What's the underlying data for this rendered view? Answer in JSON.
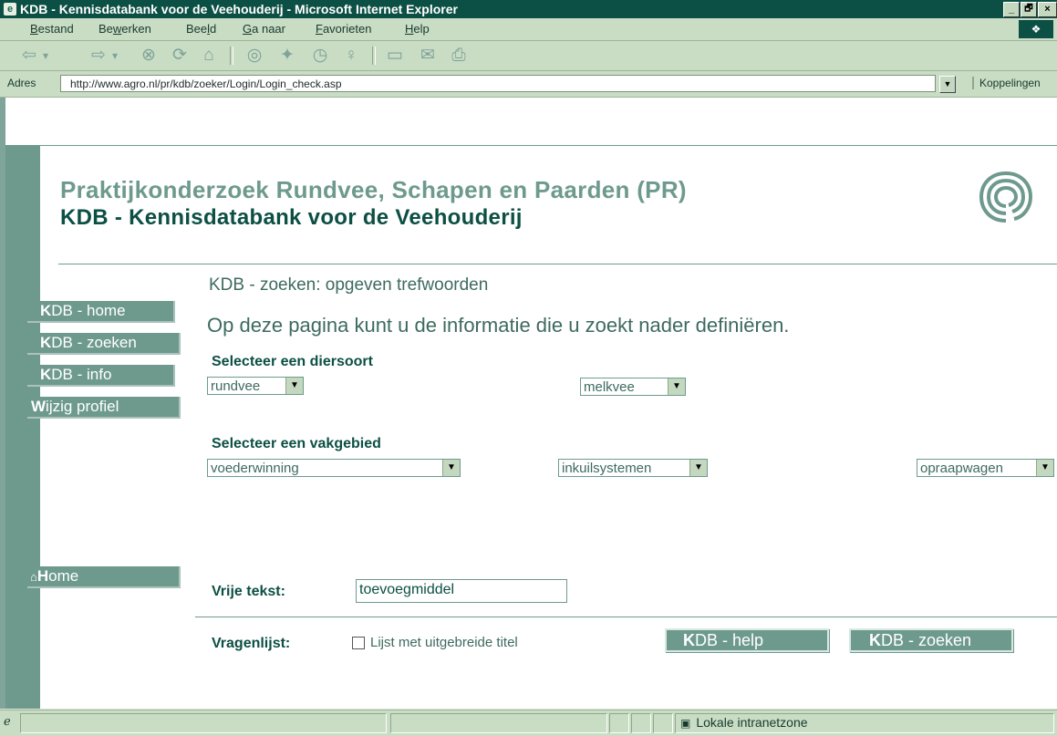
{
  "window": {
    "title": "KDB - Kennisdatabank voor de Veehouderij - Microsoft Internet Explorer",
    "controls": [
      "_",
      "🗗",
      "×"
    ]
  },
  "menu": {
    "items": [
      {
        "pre": "",
        "key": "B",
        "post": "estand"
      },
      {
        "pre": "Be",
        "key": "w",
        "post": "erken"
      },
      {
        "pre": "Bee",
        "key": "l",
        "post": "d"
      },
      {
        "pre": "",
        "key": "G",
        "post": "a naar"
      },
      {
        "pre": "",
        "key": "F",
        "post": "avorieten"
      },
      {
        "pre": "",
        "key": "H",
        "post": "elp"
      }
    ]
  },
  "toolbar": {
    "icons": [
      "back-icon",
      "back-dropdown-icon",
      "forward-icon",
      "forward-dropdown-icon",
      "stop-icon",
      "refresh-icon",
      "home-icon",
      "search-icon",
      "favorites-icon",
      "history-icon",
      "channels-icon",
      "fullscreen-icon",
      "mail-icon",
      "print-icon"
    ],
    "glyphs": {
      "back": "⇦",
      "drop": "▾",
      "forward": "⇨",
      "stop": "⊗",
      "refresh": "⟳",
      "home": "⌂",
      "search": "◎",
      "favorites": "✦",
      "history": "◷",
      "channels": "♀",
      "fullscreen": "▭",
      "mail": "✉",
      "print": "⎙"
    }
  },
  "address": {
    "label": "Adres",
    "url": "http://www.agro.nl/pr/kdb/zoeker/Login/Login_check.asp",
    "links_label": "Koppelingen"
  },
  "page": {
    "org_title": "Praktijkonderzoek Rundvee, Schapen en Paarden (PR)",
    "app_title": "KDB - Kennisdatabank voor de Veehouderij",
    "section_title": "KDB - zoeken: opgeven trefwoorden",
    "intro": "Op deze pagina kunt u de informatie die u zoekt nader definiëren.",
    "nav": [
      {
        "k": "K",
        "rest": "DB - home"
      },
      {
        "k": "K",
        "rest": "DB - zoeken"
      },
      {
        "k": "K",
        "rest": "DB - info"
      },
      {
        "k": "W",
        "rest": "ijzig profiel"
      }
    ],
    "home_nav": {
      "k": "H",
      "rest": "ome"
    },
    "animal": {
      "label": "Selecteer een diersoort",
      "species": "rundvee",
      "subtype": "melkvee"
    },
    "field": {
      "label": "Selecteer een vakgebied",
      "area": "voederwinning",
      "topic": "inkuilsystemen",
      "subtopic": "opraapwagen"
    },
    "free_text": {
      "label": "Vrije tekst:",
      "value": "toevoegmiddel"
    },
    "questionnaire": {
      "label": "Vragenlijst:",
      "checkbox_label": "Lijst met uitgebreide titel",
      "checked": false
    },
    "buttons": {
      "help": {
        "k": "K",
        "rest": "DB - help"
      },
      "search": {
        "k": "K",
        "rest": "DB - zoeken"
      }
    }
  },
  "status": {
    "zone": "Lokale intranetzone"
  },
  "colors": {
    "dark_green": "#0c4f44",
    "sage": "#6e9a8e",
    "text_green": "#3d6a5f",
    "chrome": "#c9dcc4"
  }
}
